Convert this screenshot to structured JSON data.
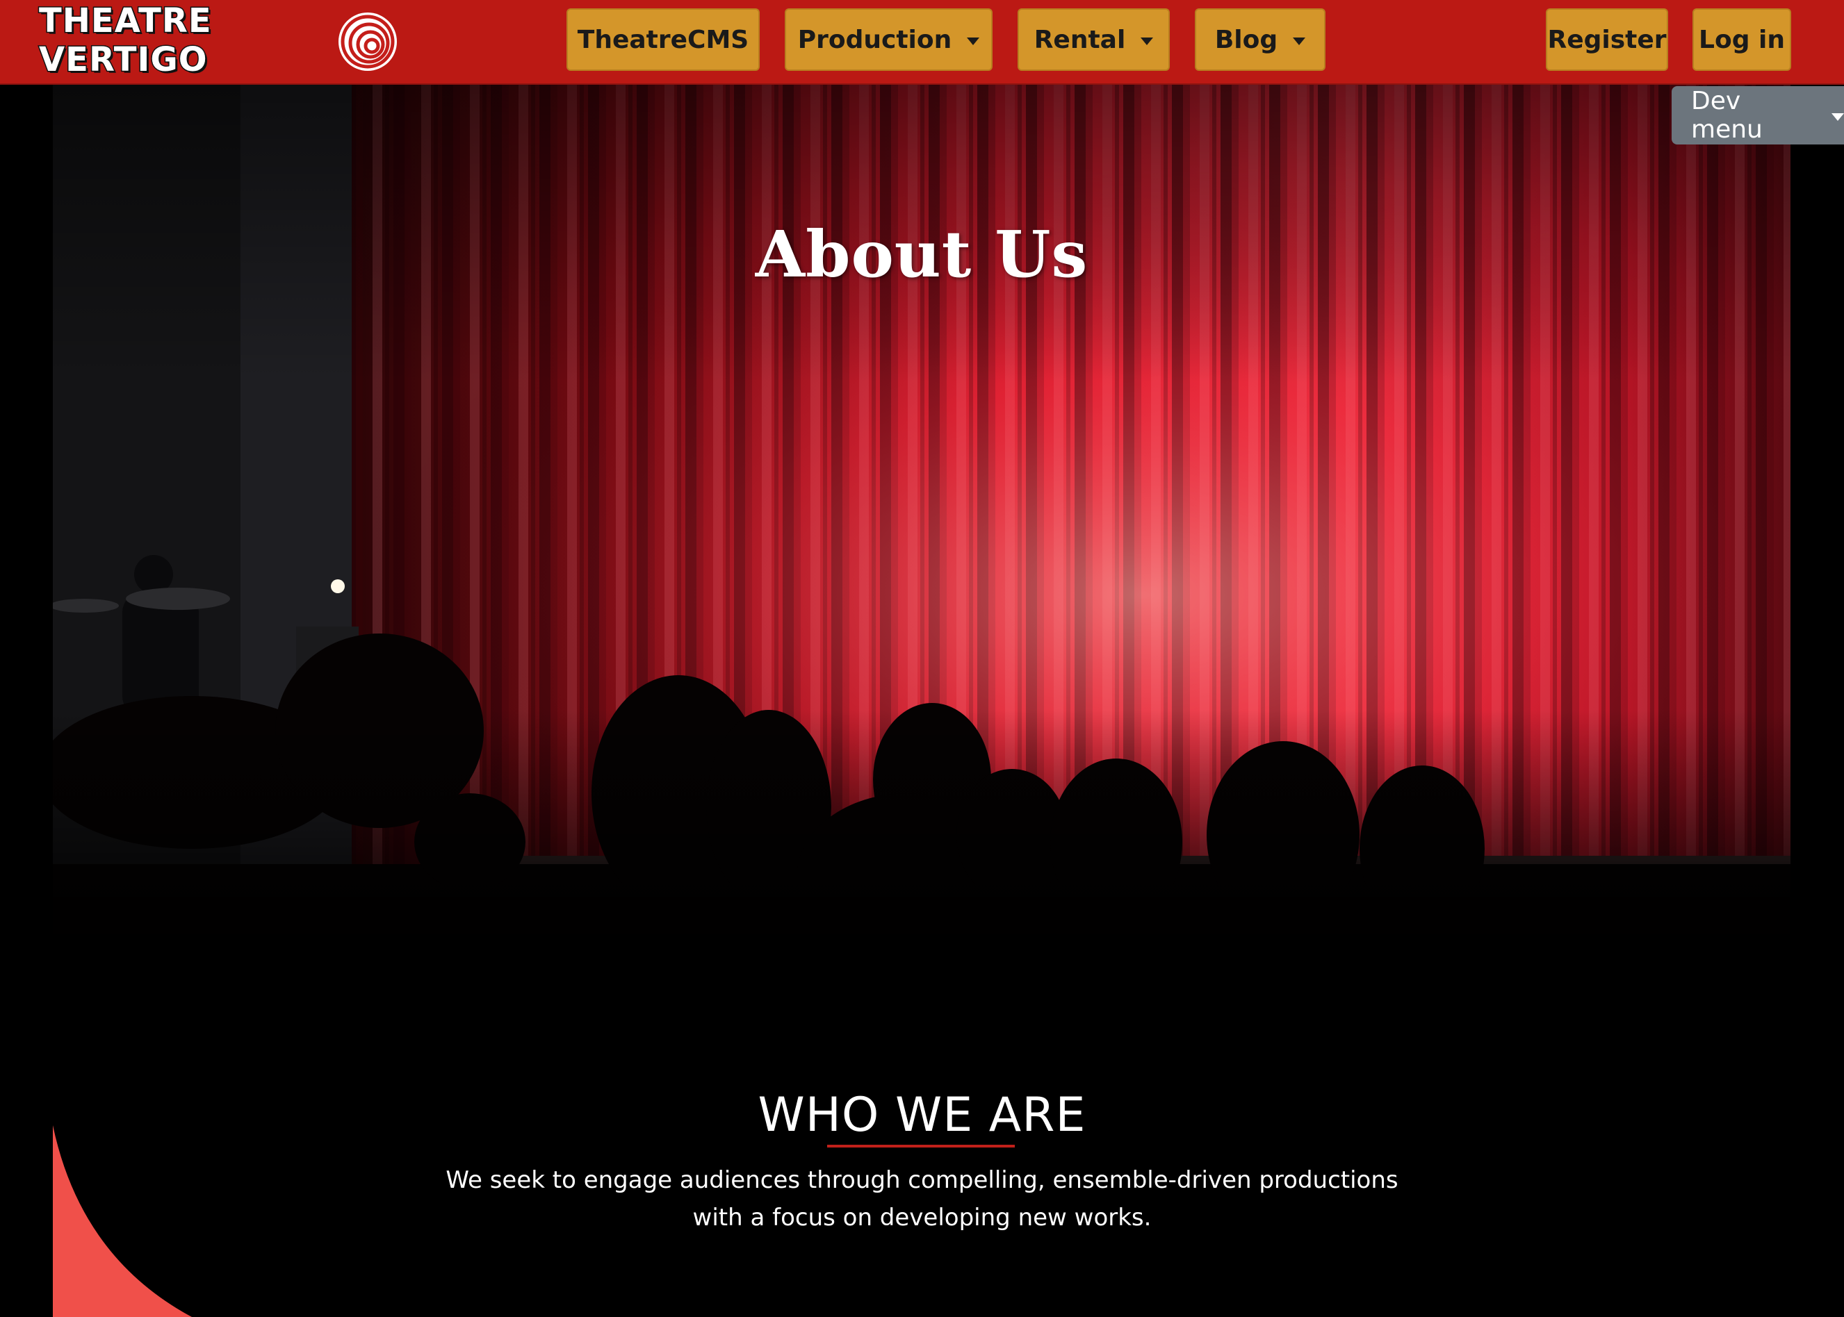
{
  "brand": {
    "logo_text": "THEATRE VERTIGO",
    "primary_color": "#bb1914",
    "button_color": "#d4962a"
  },
  "nav": {
    "theatrecms": "TheatreCMS",
    "production": "Production",
    "rental": "Rental",
    "blog": "Blog",
    "register": "Register",
    "login": "Log in",
    "dev_menu": "Dev menu"
  },
  "hero": {
    "title": "About Us"
  },
  "who": {
    "heading": "WHO WE ARE",
    "body": "We seek to engage audiences through compelling, ensemble-driven productions with a focus on developing new works."
  },
  "icons": [
    "caret-down-icon",
    "vertigo-swirl-icon"
  ]
}
